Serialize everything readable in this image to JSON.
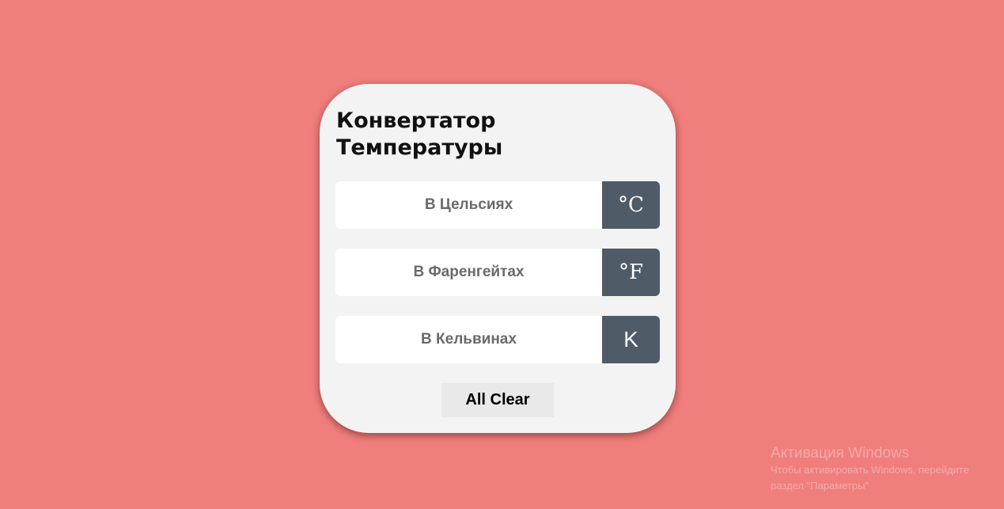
{
  "app": {
    "title": "Конвертатор Температуры"
  },
  "converter": {
    "rows": [
      {
        "placeholder": "В Цельсиях",
        "value": "",
        "unit": "°C"
      },
      {
        "placeholder": "В Фаренгейтах",
        "value": "",
        "unit": "°F"
      },
      {
        "placeholder": "В Кельвинах",
        "value": "",
        "unit": "K"
      }
    ],
    "clear_label": "All Clear"
  },
  "watermark": {
    "title": "Активация Windows",
    "line1": "Чтобы активировать Windows, перейдите",
    "line2": "раздел \"Параметры\""
  },
  "colors": {
    "background": "#f07e7c",
    "card": "#f3f3f3",
    "unit_box": "#4f5b67"
  }
}
